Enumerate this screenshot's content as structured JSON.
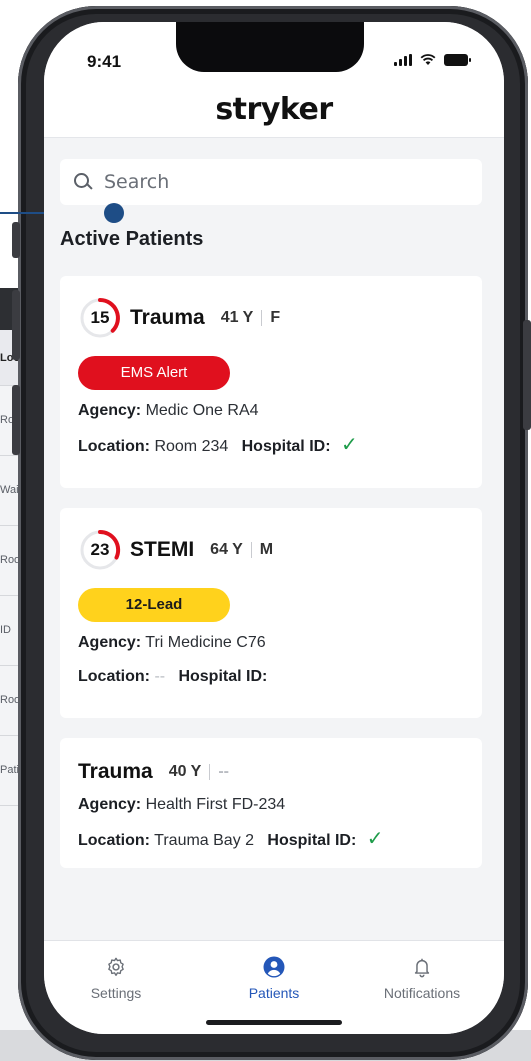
{
  "status_bar": {
    "time": "9:41"
  },
  "header": {
    "logo_text": "stryker"
  },
  "search": {
    "placeholder": "Search"
  },
  "section_title": "Active Patients",
  "background_table": {
    "rows": [
      "Loc",
      "Roo",
      "Wai",
      "Roo",
      "ID",
      "Roo",
      "Pati"
    ]
  },
  "patients": [
    {
      "score": "15",
      "type": "Trauma",
      "age": "41 Y",
      "sex": "F",
      "badge": "EMS Alert",
      "badge_color": "#e0101e",
      "agency_label": "Agency:",
      "agency": "Medic One RA4",
      "location_label": "Location:",
      "location": "Room 234",
      "hospital_id_label": "Hospital ID:",
      "hospital_id_check": "✓"
    },
    {
      "score": "23",
      "type": "STEMI",
      "age": "64 Y",
      "sex": "M",
      "badge": "12-Lead",
      "badge_color": "#ffd21c",
      "agency_label": "Agency:",
      "agency": "Tri Medicine C76",
      "location_label": "Location:",
      "location": "--",
      "hospital_id_label": "Hospital ID:",
      "hospital_id_check": ""
    },
    {
      "type": "Trauma",
      "age": "40 Y",
      "sex": "--",
      "agency_label": "Agency:",
      "agency": "Health First FD-234",
      "location_label": "Location:",
      "location": "Trauma Bay 2",
      "hospital_id_label": "Hospital ID:",
      "hospital_id_check": "✓"
    }
  ],
  "bottom_nav": {
    "items": [
      {
        "label": "Settings",
        "icon": "gear-icon",
        "active": false
      },
      {
        "label": "Patients",
        "icon": "user-icon",
        "active": true
      },
      {
        "label": "Notifications",
        "icon": "bell-icon",
        "active": false
      }
    ],
    "active_color": "#2457b8"
  },
  "colors": {
    "brand_text": "#111111",
    "connector": "#1e4d86",
    "score_ring": "#e0101e",
    "check": "#1e9c4a"
  }
}
